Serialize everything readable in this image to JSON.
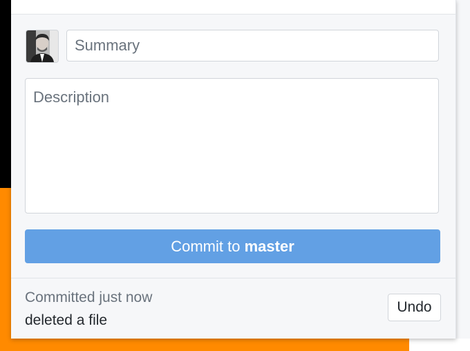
{
  "commit_form": {
    "summary": {
      "placeholder": "Summary",
      "value": ""
    },
    "description": {
      "placeholder": "Description",
      "value": ""
    },
    "commit_button": {
      "prefix": "Commit to ",
      "branch": "master"
    },
    "avatar_icon": "user-avatar-photo"
  },
  "last_commit": {
    "status": "Committed just now",
    "message": "deleted a file",
    "undo_label": "Undo"
  },
  "colors": {
    "commit_button": "#62a0e4",
    "panel_background": "#f6f7f9",
    "desktop_orange": "#ff8a00",
    "desktop_black": "#000000"
  }
}
